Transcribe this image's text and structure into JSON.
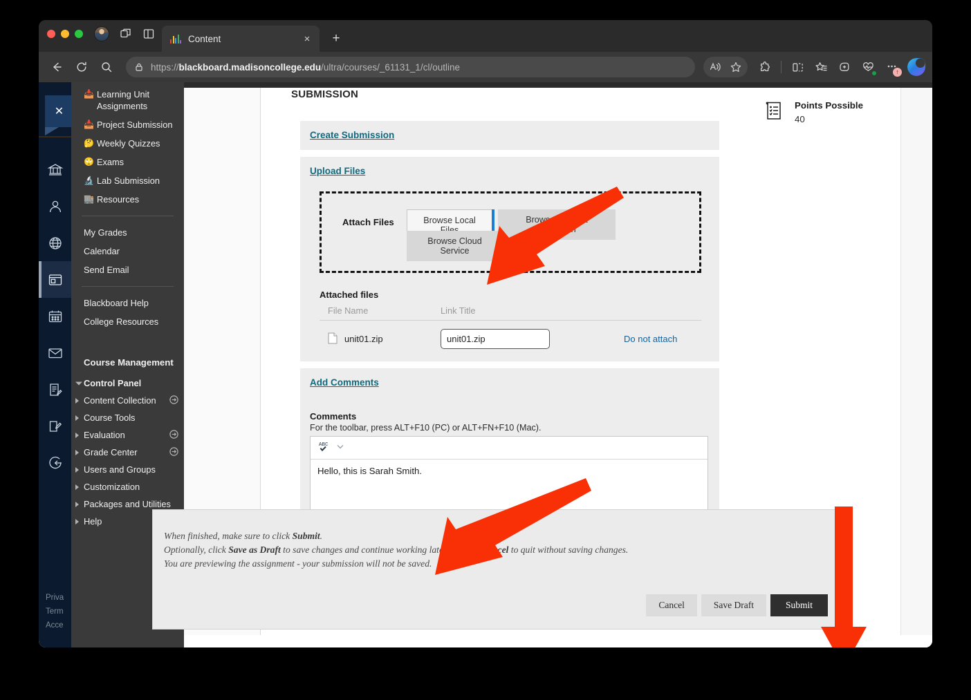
{
  "browser": {
    "tab": {
      "title": "Content",
      "favicon": "bar-chart-favicon",
      "close_label": "×"
    },
    "new_tab_label": "+",
    "url_full": "https://blackboard.madisoncollege.edu/ultra/courses/_61131_1/cl/outline",
    "url_scheme": "https://",
    "url_host": "blackboard.madisoncollege.edu",
    "url_path": "/ultra/courses/_61131_1/cl/outline",
    "toolbar_icons": [
      "back-icon",
      "reload-icon",
      "search-icon",
      "lock-icon",
      "read-aloud-icon",
      "favorite-icon",
      "extensions-icon",
      "split-screen-icon",
      "collections-icon",
      "add-tab-group-icon",
      "browser-essentials-icon",
      "settings-more-icon",
      "copilot-icon"
    ],
    "update_badge": "↑"
  },
  "blackboard": {
    "rail": {
      "close_label": "✕",
      "icons": [
        "institution-icon",
        "profile-icon",
        "globe-icon",
        "courses-icon",
        "calendar-icon",
        "messages-icon",
        "grades-icon",
        "tools-icon",
        "signout-icon"
      ],
      "footer_links": [
        "Priva",
        "Term",
        "Acce"
      ]
    },
    "course_menu": {
      "items": [
        {
          "emoji": "📥",
          "label": "Learning Unit Assignments"
        },
        {
          "emoji": "📥",
          "label": "Project Submission"
        },
        {
          "emoji": "🤔",
          "label": "Weekly Quizzes"
        },
        {
          "emoji": "🙄",
          "label": "Exams"
        },
        {
          "emoji": "🔬",
          "label": "Lab Submission"
        },
        {
          "emoji": "🏬",
          "label": "Resources"
        }
      ],
      "group2": [
        "My Grades",
        "Calendar",
        "Send Email"
      ],
      "group3": [
        "Blackboard Help",
        "College Resources"
      ],
      "management_heading": "Course Management",
      "control_panel_label": "Control Panel",
      "control_panel_items": [
        {
          "label": "Content Collection",
          "has_goto": true
        },
        {
          "label": "Course Tools",
          "has_goto": false
        },
        {
          "label": "Evaluation",
          "has_goto": true
        },
        {
          "label": "Grade Center",
          "has_goto": true
        },
        {
          "label": "Users and Groups",
          "has_goto": false
        },
        {
          "label": "Customization",
          "has_goto": false
        },
        {
          "label": "Packages and Utilities",
          "has_goto": false
        },
        {
          "label": "Help",
          "has_goto": false
        }
      ]
    }
  },
  "page": {
    "section_title": "SUBMISSION",
    "create_submission_link": "Create Submission",
    "upload_files_link": "Upload Files",
    "attach": {
      "label": "Attach Files",
      "browse_local": "Browse Local Files",
      "browse_content_collection": "Browse Content Collection",
      "browse_cloud": "Browse Cloud Service"
    },
    "attached_files": {
      "title": "Attached files",
      "columns": [
        "File Name",
        "Link Title"
      ],
      "rows": [
        {
          "file_icon": "file-icon",
          "file_name": "unit01.zip",
          "link_title_value": "unit01.zip",
          "action": "Do not attach"
        }
      ]
    },
    "add_comments_link": "Add Comments",
    "comments": {
      "label": "Comments",
      "hint": "For the toolbar, press ALT+F10 (PC) or ALT+FN+F10 (Mac).",
      "toolbar_icons": [
        "spellcheck-icon",
        "chevron-down-icon"
      ],
      "value": "Hello, this is Sarah Smith."
    },
    "points": {
      "icon": "rubric-icon",
      "title": "Points Possible",
      "value": "40"
    },
    "submit_bar": {
      "line1_pre": "When finished, make sure to click ",
      "line1_bold": "Submit",
      "line1_post": ".",
      "line2_pre": "Optionally, click ",
      "line2_bold1": "Save as Draft",
      "line2_mid": " to save changes and continue working later, or click ",
      "line2_bold2": "Cancel",
      "line2_post": " to quit without saving changes.",
      "line3": "You are previewing the assignment - your submission will not be saved.",
      "cancel_label": "Cancel",
      "save_draft_label": "Save Draft",
      "submit_label": "Submit"
    }
  },
  "annotations": {
    "color": "#f93005",
    "arrows": [
      {
        "name": "arrow-to-browse-local-files"
      },
      {
        "name": "arrow-to-comments-box"
      },
      {
        "name": "arrow-to-submit-button"
      }
    ]
  }
}
